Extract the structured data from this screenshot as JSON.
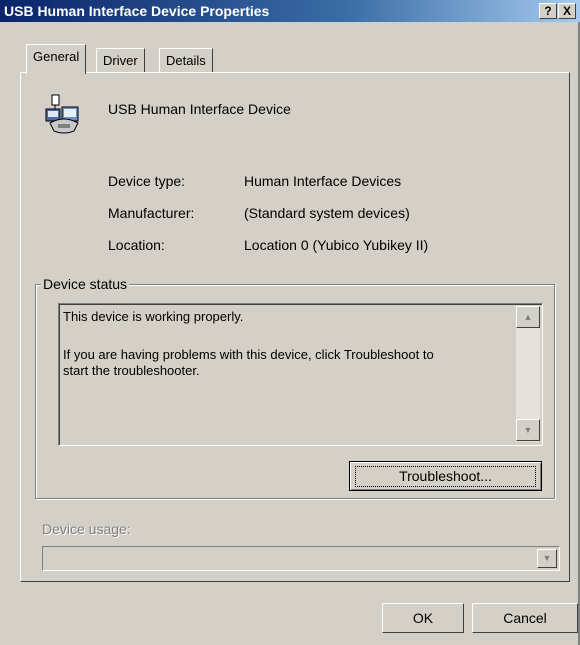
{
  "window": {
    "title": "USB Human Interface Device Properties",
    "help_button": "?",
    "close_button": "X"
  },
  "tabs": [
    {
      "label": "General",
      "active": true
    },
    {
      "label": "Driver",
      "active": false
    },
    {
      "label": "Details",
      "active": false
    }
  ],
  "device": {
    "icon": "usb-device-icon",
    "name": "USB Human Interface Device"
  },
  "properties": {
    "type_label": "Device type:",
    "type_value": "Human Interface Devices",
    "manufacturer_label": "Manufacturer:",
    "manufacturer_value": "(Standard system devices)",
    "location_label": "Location:",
    "location_value": "Location 0 (Yubico Yubikey II)"
  },
  "status": {
    "group_title": "Device status",
    "line1": "This device is working properly.",
    "line2": "If you are having problems with this device, click Troubleshoot to",
    "line3": "start the troubleshooter."
  },
  "buttons": {
    "troubleshoot": "Troubleshoot...",
    "ok": "OK",
    "cancel": "Cancel"
  },
  "usage": {
    "label": "Device usage:",
    "value": ""
  },
  "colors": {
    "titlebar_start": "#0a246a",
    "titlebar_end": "#a6caf0",
    "face": "#d4d0c8"
  }
}
